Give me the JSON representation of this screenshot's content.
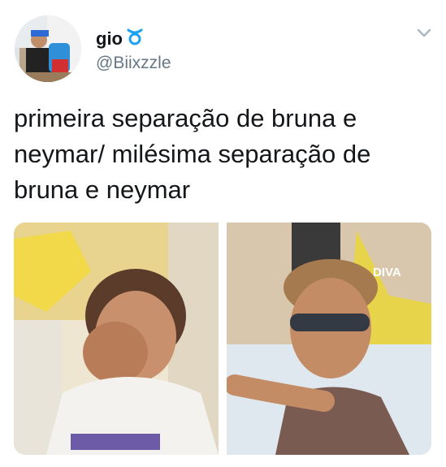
{
  "user": {
    "display_name": "gio",
    "name_emoji_icon": "taurus-emoji-icon",
    "handle": "@Biixzzle"
  },
  "menu": {
    "icon": "chevron-down-icon"
  },
  "tweet": {
    "text": "primeira separação de bruna e neymar/ milésima separação de bruna e neymar"
  },
  "media": {
    "images": [
      {
        "description_icon": "photo-crying"
      },
      {
        "description_icon": "photo-sunglasses",
        "poster_text": "DIVA"
      }
    ]
  },
  "colors": {
    "text": "#14171a",
    "secondary": "#657786",
    "accent": "#1da1f2"
  }
}
